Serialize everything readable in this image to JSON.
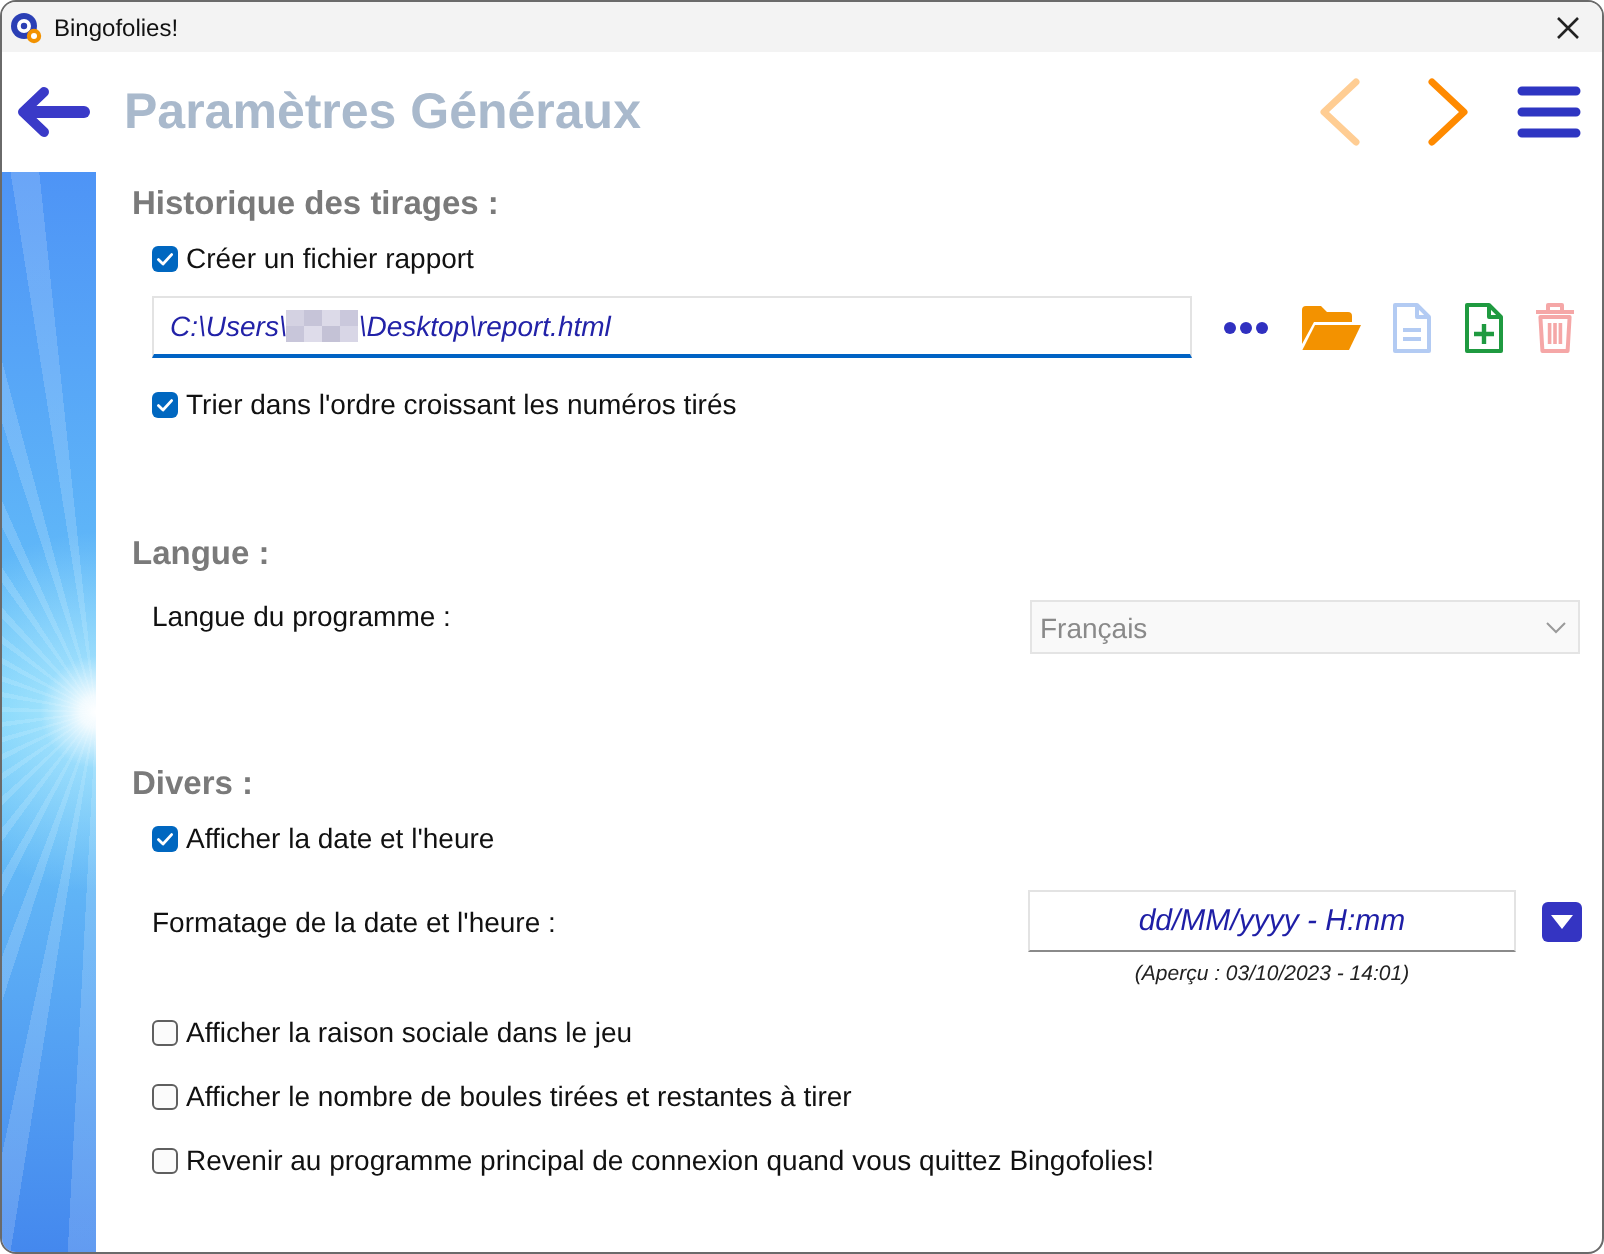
{
  "window": {
    "title": "Bingofolies!"
  },
  "header": {
    "title": "Paramètres Généraux",
    "nav_buttons": [
      {
        "kind": "previous",
        "disabled": true
      },
      {
        "kind": "next",
        "disabled": false
      }
    ]
  },
  "sections": [
    {
      "heading": "Historique des tirages :",
      "items": [
        {
          "kind": "checkbox",
          "label": "Créer un fichier rapport",
          "checked": true
        },
        {
          "kind": "path",
          "value_start": "C:\\Users\\",
          "redacted": true,
          "value_end": "\\Desktop\\report.html",
          "actions": [
            {
              "kind": "more",
              "disabled": false
            },
            {
              "kind": "folder",
              "disabled": false
            },
            {
              "kind": "document",
              "disabled": true
            },
            {
              "kind": "new_document",
              "disabled": false
            },
            {
              "kind": "trash",
              "disabled": true
            }
          ]
        },
        {
          "kind": "checkbox",
          "label": "Trier dans l'ordre croissant les numéros tirés",
          "checked": true
        }
      ]
    },
    {
      "heading": "Langue :",
      "items": [
        {
          "kind": "select",
          "label": "Langue du programme :",
          "value": "Français",
          "disabled": true
        }
      ]
    },
    {
      "heading": "Divers :",
      "items": [
        {
          "kind": "checkbox",
          "label": "Afficher la date et l'heure",
          "checked": true
        },
        {
          "kind": "format",
          "label": "Formatage de la date et l'heure :",
          "value": "dd/MM/yyyy - H:mm",
          "preview": "(Aperçu : 03/10/2023 - 14:01)"
        },
        {
          "kind": "checkbox",
          "label": "Afficher la raison sociale dans le jeu",
          "checked": false
        },
        {
          "kind": "checkbox",
          "label": "Afficher le nombre de boules tirées et restantes à tirer",
          "checked": false
        },
        {
          "kind": "checkbox",
          "label": "Revenir au programme principal de connexion quand vous quittez Bingofolies!",
          "checked": false
        }
      ]
    }
  ]
}
